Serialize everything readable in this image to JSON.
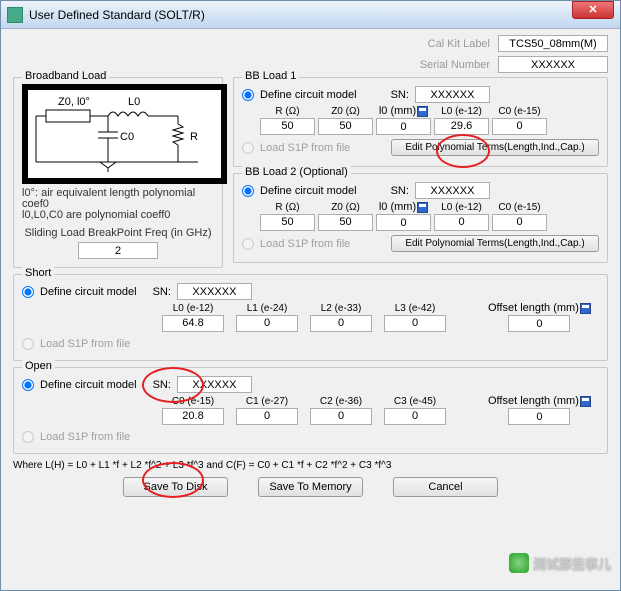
{
  "window": {
    "title": "User Defined Standard (SOLT/R)"
  },
  "cal_kit": {
    "label": "Cal Kit Label",
    "value": "TCS50_08mm(M)"
  },
  "serial": {
    "label": "Serial Number",
    "value": "XXXXXX"
  },
  "broadband": {
    "group_title": "Broadband Load",
    "diagram": {
      "z0": "Z0, l0°",
      "l0": "L0",
      "c0": "C0",
      "r": "R"
    },
    "note_line1": "l0°: air equivalent length polynomial coef0",
    "note_line2": "l0,L0,C0 are polynomial coeff0",
    "sliding_label": "Sliding Load BreakPoint Freq (in GHz)",
    "sliding_value": "2"
  },
  "bb1": {
    "group_title": "BB Load 1",
    "define_circuit": "Define circuit model",
    "sn_label": "SN:",
    "sn_value": "XXXXXX",
    "cols": {
      "r": "R (Ω)",
      "z0": "Z0 (Ω)",
      "l0mm": "l0 (mm)",
      "l0e12": "L0 (e-12)",
      "c0e15": "C0 (e-15)"
    },
    "vals": {
      "r": "50",
      "z0": "50",
      "l0mm": "0",
      "l0e12": "29.6",
      "c0e15": "0"
    },
    "load_s1p": "Load S1P from file",
    "edit_poly": "Edit Polynomial Terms(Length,Ind.,Cap.)"
  },
  "bb2": {
    "group_title": "BB Load 2 (Optional)",
    "define_circuit": "Define circuit model",
    "sn_label": "SN:",
    "sn_value": "XXXXXX",
    "cols": {
      "r": "R (Ω)",
      "z0": "Z0 (Ω)",
      "l0mm": "l0 (mm)",
      "l0e12": "L0 (e-12)",
      "c0e15": "C0 (e-15)"
    },
    "vals": {
      "r": "50",
      "z0": "50",
      "l0mm": "0",
      "l0e12": "0",
      "c0e15": "0"
    },
    "load_s1p": "Load S1P from file",
    "edit_poly": "Edit Polynomial Terms(Length,Ind.,Cap.)"
  },
  "short": {
    "group_title": "Short",
    "define_circuit": "Define circuit model",
    "sn_label": "SN:",
    "sn_value": "XXXXXX",
    "cols": {
      "l0": "L0 (e-12)",
      "l1": "L1 (e-24)",
      "l2": "L2 (e-33)",
      "l3": "L3 (e-42)",
      "offset": "Offset length (mm)"
    },
    "vals": {
      "l0": "64.8",
      "l1": "0",
      "l2": "0",
      "l3": "0",
      "offset": "0"
    },
    "load_s1p": "Load S1P from file"
  },
  "open": {
    "group_title": "Open",
    "define_circuit": "Define circuit model",
    "sn_label": "SN:",
    "sn_value": "XXXXXX",
    "cols": {
      "c0": "C0 (e-15)",
      "c1": "C1 (e-27)",
      "c2": "C2 (e-36)",
      "c3": "C3 (e-45)",
      "offset": "Offset length (mm)"
    },
    "vals": {
      "c0": "20.8",
      "c1": "0",
      "c2": "0",
      "c3": "0",
      "offset": "0"
    },
    "load_s1p": "Load S1P from file"
  },
  "where": "Where L(H) = L0 + L1 *f + L2 *f^2 + L3 *f^3  and  C(F) = C0 + C1 *f + C2 *f^2 + C3 *f^3",
  "buttons": {
    "save_disk": "Save To Disk",
    "save_mem": "Save To Memory",
    "cancel": "Cancel"
  },
  "watermark": "测试那些事儿"
}
